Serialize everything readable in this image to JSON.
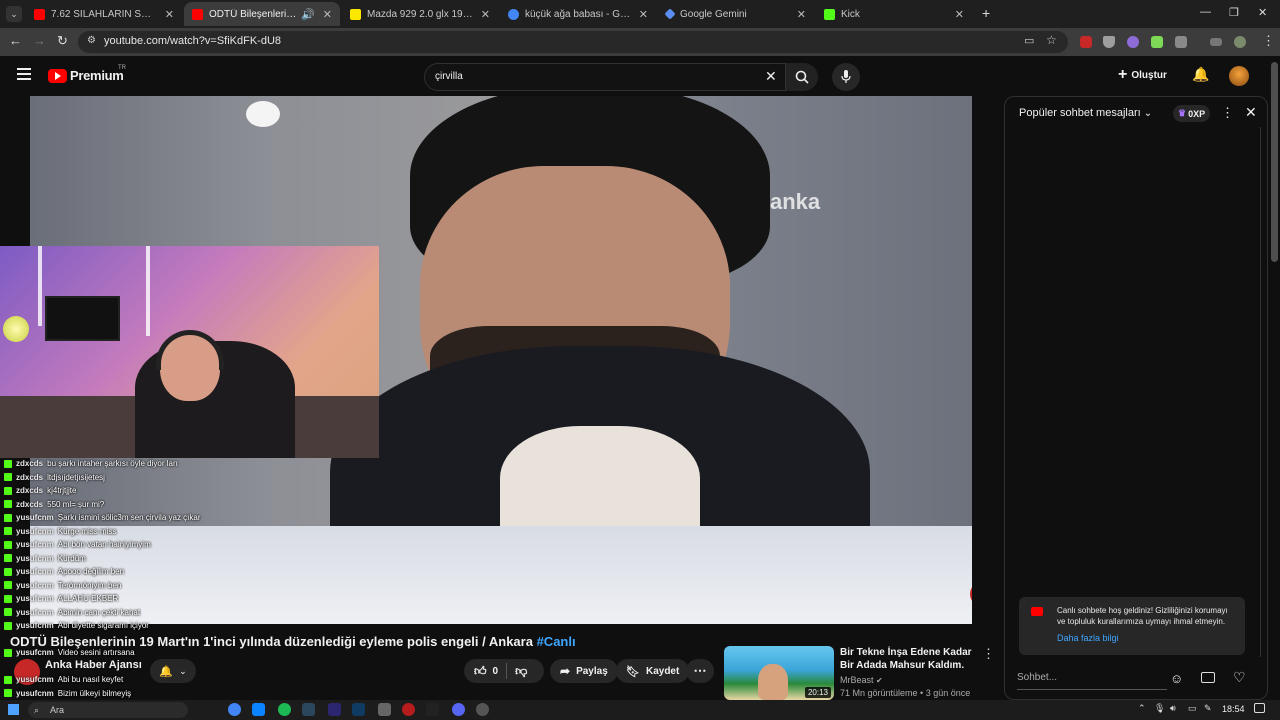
{
  "tabs": [
    {
      "title": "7.62 SİLAHLARIN SESİ BİLE ÇAY",
      "favicon_color": "#ff0000"
    },
    {
      "title": "ODTÜ Bileşenlerinin 19 Mar",
      "favicon_color": "#ff0000",
      "active": true
    },
    {
      "title": "Mazda 929 2.0 glx 1991 - Türkiy",
      "favicon_color": "#ffe800"
    },
    {
      "title": "küçük ağa babası - Google'da A",
      "favicon_color": "#4285f4"
    },
    {
      "title": "Google Gemini",
      "favicon_color": "#5b8def"
    },
    {
      "title": "Kick",
      "favicon_color": "#53fc18"
    }
  ],
  "new_tab_label": "+",
  "address": {
    "url": "youtube.com/watch?v=SfiKdFK-dU8"
  },
  "youtube": {
    "logo_text": "Premium",
    "logo_badge": "TR",
    "search_value": "çirvilla",
    "create_label": "Oluştur"
  },
  "video": {
    "watermark": "anka",
    "title": "ODTÜ Bileşenlerinin 19 Mart'ın 1'inci yılında düzenlediği eyleme polis engeli / Ankara",
    "title_tag": "#Canlı",
    "channel": "Anka Haber Ajansı",
    "like_count": "0",
    "share_label": "Paylaş",
    "save_label": "Kaydet"
  },
  "chat_overlay": [
    {
      "user": "zdxcds",
      "msg": "bu şarkı intaher şarkısı öyle diyor ları"
    },
    {
      "user": "zdxcds",
      "msg": "ltdjsıjdetjısijetesj"
    },
    {
      "user": "zdxcds",
      "msg": "kj4trjtjjte"
    },
    {
      "user": "zdxcds",
      "msg": "550 ml= şur mi?"
    },
    {
      "user": "yusufcnm",
      "msg": "Şarkı ismini sölic3m sen çirvila yaz çıkar"
    },
    {
      "user": "yusufcnm",
      "msg": "Kürge miss miss"
    },
    {
      "user": "yusufcnm",
      "msg": "Abi bön vatan hainiyimyim"
    },
    {
      "user": "yusufcnm",
      "msg": "Kürdüm"
    },
    {
      "user": "yusufcnm",
      "msg": "Apooo değilim ben"
    },
    {
      "user": "yusufcnm",
      "msg": "Terörmöniyim ben"
    },
    {
      "user": "yusufcnm",
      "msg": "ALLAHU EKBER"
    },
    {
      "user": "yusufcnm",
      "msg": "Abimin canı çekti kanat"
    },
    {
      "user": "yusufcnm",
      "msg": "Abi diyette sigaramı içiyor"
    },
    {
      "user": "yusufcnm",
      "msg": "Video sesini artırsana"
    },
    {
      "user": "yusufcnm",
      "msg": "Abi bu nasıl keyfet"
    },
    {
      "user": "yusufcnm",
      "msg": "Bizim ülkeyi bilmeyiş"
    }
  ],
  "recommendation": {
    "title": "Bir Tekne İnşa Edene Kadar Bir Adada Mahsur Kaldım.",
    "channel": "MrBeast",
    "meta": "71 Mn görüntüleme • 3 gün önce",
    "duration": "20:13"
  },
  "chat_panel": {
    "header": "Popüler sohbet mesajları",
    "xp_label": "0XP",
    "welcome_text": "Canlı sohbete hoş geldiniz! Gizliliğinizi korumayı ve topluluk kurallarımıza uymayı ihmal etmeyin.",
    "learn_more": "Daha fazla bilgi",
    "input_placeholder": "Sohbet..."
  },
  "taskbar": {
    "search_label": "Ara",
    "time": "18:54"
  }
}
